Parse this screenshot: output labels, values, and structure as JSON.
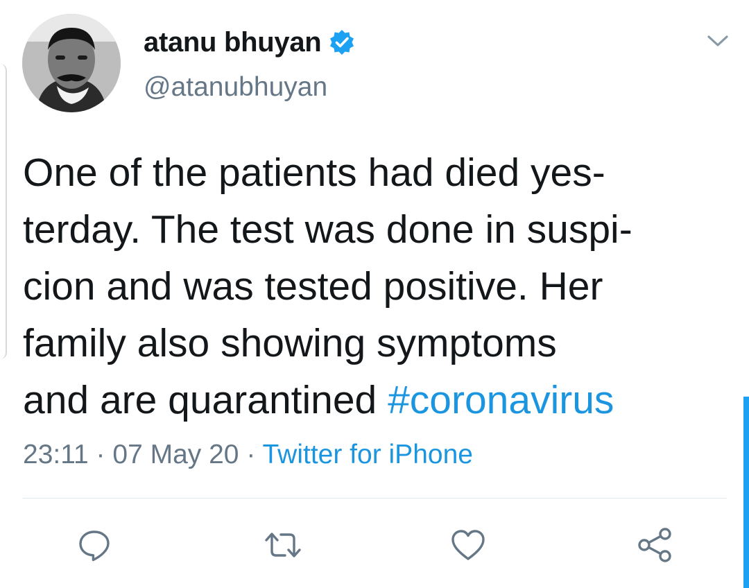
{
  "tweet": {
    "user_name": "atanu bhuyan",
    "handle": "@atanubhuyan",
    "verified_icon": "verified-badge-icon",
    "text_lines": [
      "One of the patients had died yes-",
      "terday. The test was done in suspi-",
      "cion and was tested positive. Her",
      "family also showing symptoms",
      "and are quarantined "
    ],
    "hashtag": "#coronavirus",
    "time": "23:11",
    "separator": "·",
    "date": "07 May 20",
    "source": "Twitter for iPhone"
  },
  "actions": [
    {
      "name": "reply",
      "icon": "reply-icon"
    },
    {
      "name": "retweet",
      "icon": "retweet-icon"
    },
    {
      "name": "like",
      "icon": "heart-icon"
    },
    {
      "name": "share",
      "icon": "share-icon"
    }
  ],
  "colors": {
    "accent": "#1da1f2",
    "link": "#1b95e0",
    "secondary_text": "#657786",
    "primary_text": "#14171a",
    "divider": "#e1e8ed"
  }
}
